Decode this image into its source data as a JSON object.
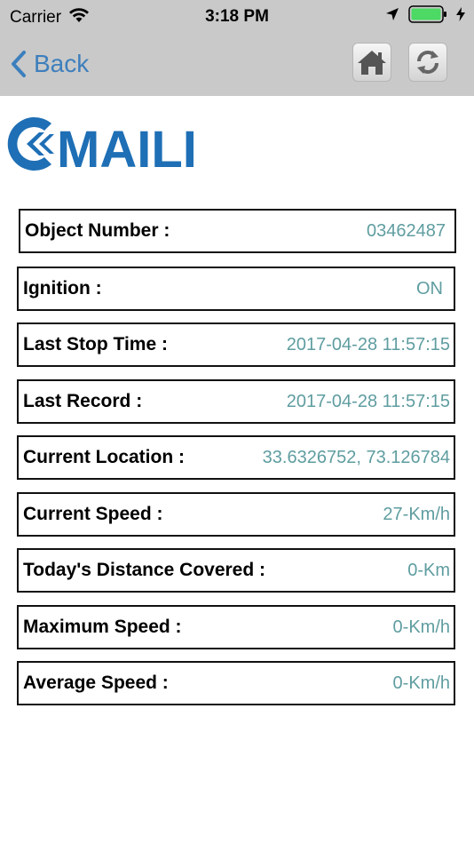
{
  "status_bar": {
    "carrier": "Carrier",
    "time": "3:18 PM"
  },
  "nav": {
    "back_label": "Back"
  },
  "logo": {
    "text": "MAILI",
    "color": "#1e6fb5"
  },
  "fields": [
    {
      "label": "Object Number :",
      "value": "03462487"
    },
    {
      "label": "Ignition :",
      "value": "ON"
    },
    {
      "label": "Last Stop Time :",
      "value": "2017-04-28 11:57:15"
    },
    {
      "label": "Last Record :",
      "value": "2017-04-28 11:57:15"
    },
    {
      "label": "Current Location :",
      "value": "33.6326752, 73.126784"
    },
    {
      "label": "Current Speed :",
      "value": "27-Km/h"
    },
    {
      "label": "Today's Distance Covered :",
      "value": "0-Km"
    },
    {
      "label": "Maximum Speed :",
      "value": "0-Km/h"
    },
    {
      "label": "Average Speed :",
      "value": "0-Km/h"
    }
  ]
}
